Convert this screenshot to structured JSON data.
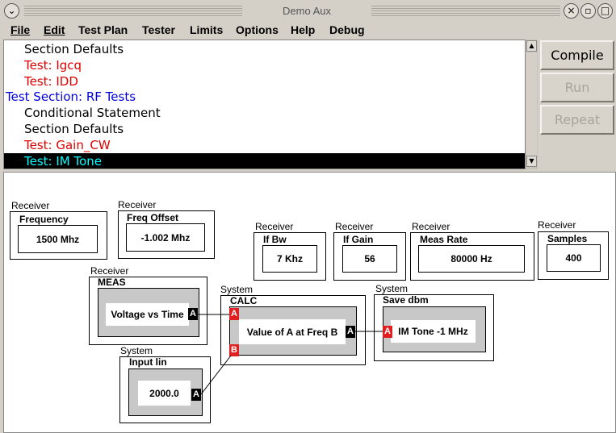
{
  "window": {
    "title": "Demo Aux"
  },
  "menu": [
    "File",
    "Edit",
    "Test Plan",
    "Tester",
    "Limits",
    "Options",
    "Help",
    "Debug"
  ],
  "list": [
    {
      "text": "Section Defaults",
      "color": "black",
      "indent": true
    },
    {
      "text": "Test: Igcq",
      "color": "red",
      "indent": true
    },
    {
      "text": "Test: IDD",
      "color": "red",
      "indent": true
    },
    {
      "text": "Test Section: RF Tests",
      "color": "blue",
      "indent": false
    },
    {
      "text": "Conditional Statement",
      "color": "black",
      "indent": true
    },
    {
      "text": "Section Defaults",
      "color": "black",
      "indent": true
    },
    {
      "text": "Test: Gain_CW",
      "color": "red",
      "indent": true
    },
    {
      "text": "Test: IM Tone",
      "color": "selected",
      "indent": true
    }
  ],
  "buttons": {
    "compile": "Compile",
    "run": "Run",
    "repeat": "Repeat"
  },
  "canvas": {
    "frequency": {
      "group": "Receiver",
      "label": "Frequency",
      "value": "1500 Mhz"
    },
    "freq_offset": {
      "group": "Receiver",
      "label": "Freq Offset",
      "value": "-1.002  Mhz"
    },
    "if_bw": {
      "group": "Receiver",
      "label": "If Bw",
      "value": "7 Khz"
    },
    "if_gain": {
      "group": "Receiver",
      "label": "If Gain",
      "value": "56"
    },
    "meas_rate": {
      "group": "Receiver",
      "label": "Meas Rate",
      "value": "80000 Hz"
    },
    "samples": {
      "group": "Receiver",
      "label": "Samples",
      "value": "400"
    },
    "meas": {
      "group": "Receiver",
      "label": "MEAS",
      "value": "Voltage vs Time",
      "port": "A"
    },
    "calc": {
      "group": "System",
      "label": "CALC",
      "value": "Value of A at Freq B",
      "in_a": "A",
      "in_b": "B",
      "out": "A"
    },
    "save": {
      "group": "System",
      "label": "Save dbm",
      "value": "IM Tone -1 MHz",
      "in": "A"
    },
    "input": {
      "group": "System",
      "label": "Input  lin",
      "value": "2000.0",
      "port": "A"
    }
  }
}
